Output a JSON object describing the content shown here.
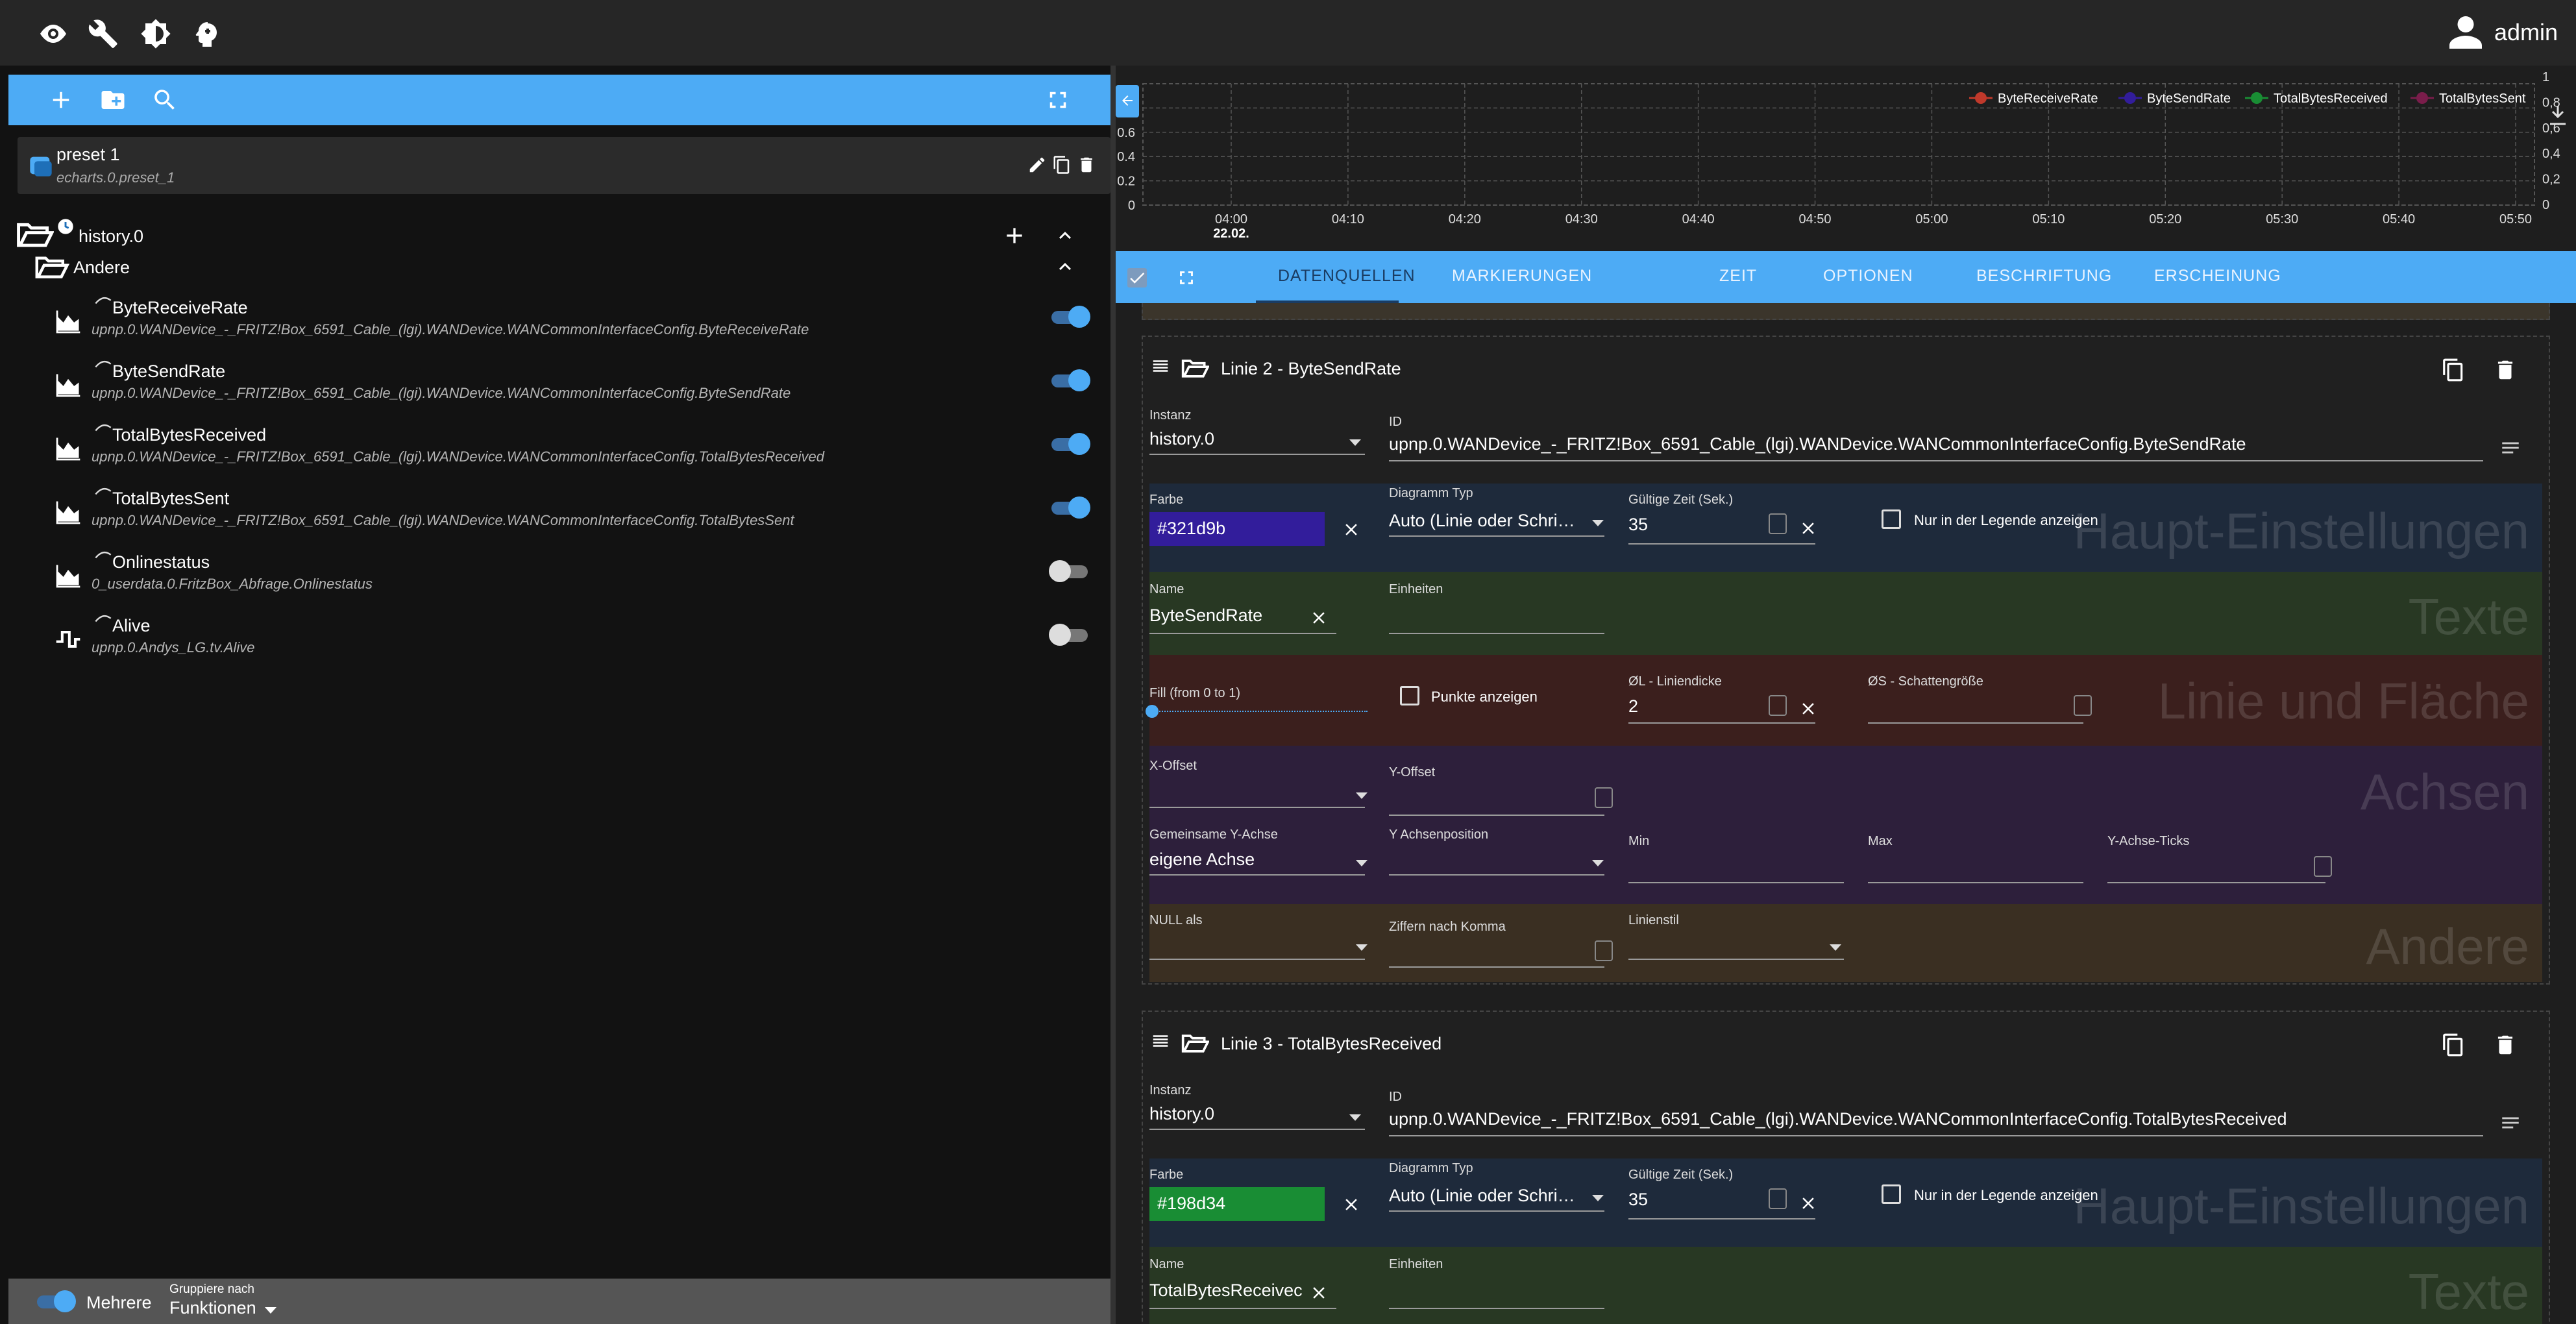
{
  "topbar": {
    "user": "admin",
    "icons": [
      "eye-icon",
      "wrench-icon",
      "brightness-icon",
      "head-icon"
    ]
  },
  "left": {
    "preset": {
      "name": "preset 1",
      "path": "echarts.0.preset_1"
    },
    "root": {
      "name": "history.0"
    },
    "group": {
      "name": "Andere"
    },
    "items": [
      {
        "name": "ByteReceiveRate",
        "id": "upnp.0.WANDevice_-_FRITZ!Box_6591_Cable_(lgi).WANDevice.WANCommonInterfaceConfig.ByteReceiveRate",
        "on": true,
        "icon": "area-chart-icon"
      },
      {
        "name": "ByteSendRate",
        "id": "upnp.0.WANDevice_-_FRITZ!Box_6591_Cable_(lgi).WANDevice.WANCommonInterfaceConfig.ByteSendRate",
        "on": true,
        "icon": "area-chart-icon"
      },
      {
        "name": "TotalBytesReceived",
        "id": "upnp.0.WANDevice_-_FRITZ!Box_6591_Cable_(lgi).WANDevice.WANCommonInterfaceConfig.TotalBytesReceived",
        "on": true,
        "icon": "area-chart-icon"
      },
      {
        "name": "TotalBytesSent",
        "id": "upnp.0.WANDevice_-_FRITZ!Box_6591_Cable_(lgi).WANDevice.WANCommonInterfaceConfig.TotalBytesSent",
        "on": true,
        "icon": "area-chart-icon"
      },
      {
        "name": "Onlinestatus",
        "id": "0_userdata.0.FritzBox_Abfrage.Onlinestatus",
        "on": false,
        "icon": "area-chart-icon"
      },
      {
        "name": "Alive",
        "id": "upnp.0.Andys_LG.tv.Alive",
        "on": false,
        "icon": "step-chart-icon"
      }
    ],
    "footer": {
      "multi_label": "Mehrere",
      "group_by_label": "Gruppiere nach",
      "group_by_value": "Funktionen"
    }
  },
  "chart_data": {
    "type": "line",
    "x": [
      "04:00",
      "04:10",
      "04:20",
      "04:30",
      "04:40",
      "04:50",
      "05:00",
      "05:10",
      "05:20",
      "05:30",
      "05:40",
      "05:50"
    ],
    "x_sublabel": "22.02.",
    "y_left_ticks": [
      "0",
      "0.2",
      "0.4",
      "0.6"
    ],
    "y_right_ticks": [
      "0",
      "0,2",
      "0,4",
      "0,6",
      "0,8",
      "1"
    ],
    "series": [
      {
        "name": "ByteReceiveRate",
        "color": "#c0392b",
        "values": []
      },
      {
        "name": "ByteSendRate",
        "color": "#321d9b",
        "values": []
      },
      {
        "name": "TotalBytesReceived",
        "color": "#198d34",
        "values": []
      },
      {
        "name": "TotalBytesSent",
        "color": "#7a1d4b",
        "values": []
      }
    ],
    "grid": true,
    "legend": "top-right"
  },
  "tabs": [
    "DATENQUELLEN",
    "MARKIERUNGEN",
    "ZEIT",
    "OPTIONEN",
    "BESCHRIFTUNG",
    "ERSCHEINUNG"
  ],
  "labels": {
    "instance": "Instanz",
    "id": "ID",
    "color": "Farbe",
    "chart_type": "Diagramm Typ",
    "valid_time": "Gültige Zeit (Sek.)",
    "legend_only": "Nur in der Legende anzeigen",
    "name": "Name",
    "units": "Einheiten",
    "fill": "Fill (from 0 to 1)",
    "points": "Punkte anzeigen",
    "line_width": "ØL - Liniendicke",
    "shadow": "ØS - Schattengröße",
    "x_offset": "X-Offset",
    "y_offset": "Y-Offset",
    "common_y": "Gemeinsame Y-Achse",
    "y_axis_pos": "Y Achsenposition",
    "min": "Min",
    "max": "Max",
    "y_ticks": "Y-Achse-Ticks",
    "null_as": "NULL als",
    "decimals": "Ziffern nach Komma",
    "line_style": "Linienstil"
  },
  "sections": {
    "main": "Haupt-Einstellungen",
    "texts": "Texte",
    "line_area": "Linie und Fläche",
    "axes": "Achsen",
    "other": "Andere"
  },
  "lines": [
    {
      "title": "Linie 2 - ByteSendRate",
      "instance": "history.0",
      "id": "upnp.0.WANDevice_-_FRITZ!Box_6591_Cable_(lgi).WANDevice.WANCommonInterfaceConfig.ByteSendRate",
      "color": "#321d9b",
      "chart_type": "Auto (Linie oder Schri…",
      "valid_time": "35",
      "name": "ByteSendRate",
      "units": "",
      "line_width": "2",
      "common_y": "eigene Achse"
    },
    {
      "title": "Linie 3 - TotalBytesReceived",
      "instance": "history.0",
      "id": "upnp.0.WANDevice_-_FRITZ!Box_6591_Cable_(lgi).WANDevice.WANCommonInterfaceConfig.TotalBytesReceived",
      "color": "#198d34",
      "chart_type": "Auto (Linie oder Schri…",
      "valid_time": "35",
      "name": "TotalBytesReceivec",
      "units": ""
    }
  ]
}
